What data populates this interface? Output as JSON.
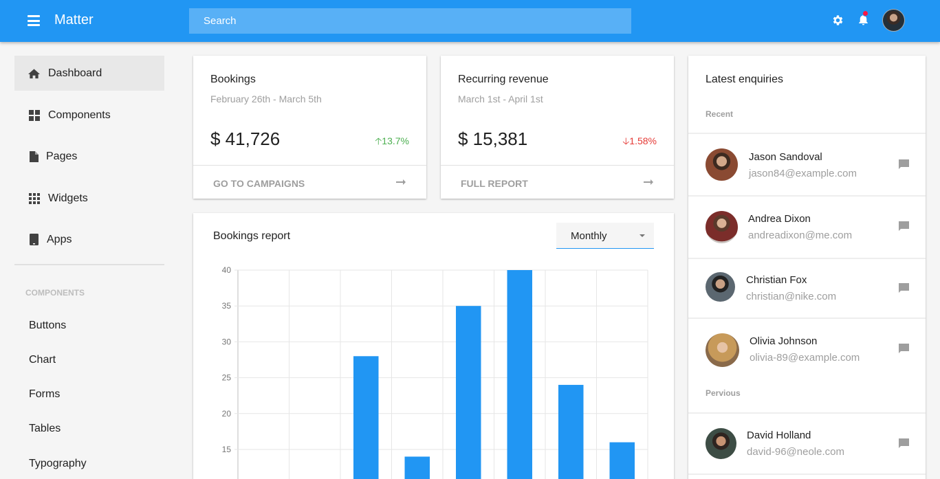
{
  "app": {
    "title": "Matter"
  },
  "search": {
    "placeholder": "Search"
  },
  "colors": {
    "primary": "#2196f3",
    "positive": "#4caf50",
    "negative": "#e53935",
    "notification": "#ff1744"
  },
  "topbar_icons": [
    "menu-icon",
    "gear-icon",
    "bell-icon",
    "avatar"
  ],
  "sidebar": {
    "items": [
      {
        "label": "Dashboard",
        "icon": "home-icon",
        "active": true
      },
      {
        "label": "Components",
        "icon": "grid-icon",
        "active": false
      },
      {
        "label": "Pages",
        "icon": "file-icon",
        "active": false
      },
      {
        "label": "Widgets",
        "icon": "apps-icon",
        "active": false
      },
      {
        "label": "Apps",
        "icon": "tablet-icon",
        "active": false
      }
    ],
    "section_label": "COMPONENTS",
    "sub_items": [
      "Buttons",
      "Chart",
      "Forms",
      "Tables",
      "Typography"
    ]
  },
  "bookings": {
    "title": "Bookings",
    "date_range": "February 26th - March 5th",
    "value": "$ 41,726",
    "change": "13.7%",
    "change_direction": "up",
    "link": "GO TO CAMPAIGNS"
  },
  "revenue": {
    "title": "Recurring revenue",
    "date_range": "March 1st - April 1st",
    "value": "$ 15,381",
    "change": "1.58%",
    "change_direction": "down",
    "link": "FULL REPORT"
  },
  "report": {
    "title": "Bookings report",
    "period_selected": "Monthly"
  },
  "chart_data": {
    "type": "bar",
    "title": "",
    "xlabel": "",
    "ylabel": "",
    "ylim": [
      10,
      40
    ],
    "yticks": [
      15,
      20,
      25,
      30,
      35,
      40
    ],
    "grid": true,
    "color": "#2196f3",
    "values": [
      null,
      null,
      28,
      14,
      35,
      40,
      24,
      16
    ]
  },
  "enquiries": {
    "title": "Latest enquiries",
    "recent_label": "Recent",
    "previous_label": "Pervious",
    "recent": [
      {
        "name": "Jason Sandoval",
        "email": "jason84@example.com"
      },
      {
        "name": "Andrea Dixon",
        "email": "andreadixon@me.com"
      },
      {
        "name": "Christian Fox",
        "email": "christian@nike.com"
      },
      {
        "name": "Olivia Johnson",
        "email": "olivia-89@example.com"
      }
    ],
    "previous": [
      {
        "name": "David Holland",
        "email": "david-96@neole.com"
      }
    ]
  }
}
